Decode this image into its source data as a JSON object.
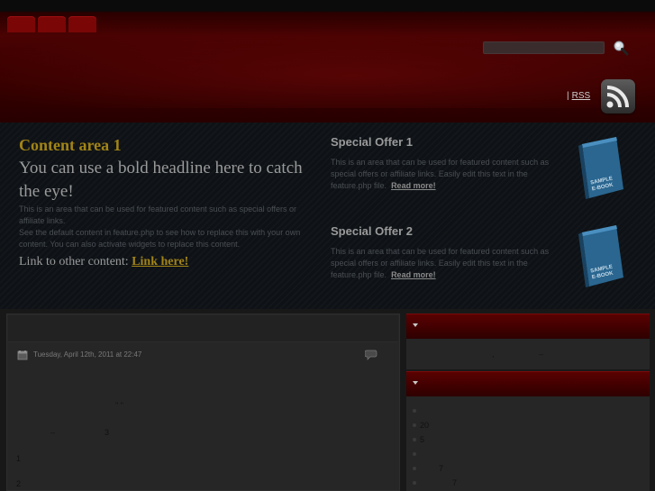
{
  "header": {
    "search": {
      "placeholder": "",
      "icon": "search-icon"
    },
    "rss": {
      "sep_link": "",
      "divider": "|",
      "label": "RSS"
    },
    "colors": {
      "nav_tab": "#7a0606",
      "header_red": "#4a0202"
    }
  },
  "feature": {
    "content_area": {
      "title": "Content area 1",
      "headline": "You can use a bold headline here to catch the eye!",
      "text1": "This is an area that can be used for featured content such as special offers or affiliate links.",
      "text2": "See the default content in feature.php to see how to replace this with your own content. You can also activate widgets to replace this content.",
      "link_prefix": "Link to other content:",
      "link_label": "Link here!"
    },
    "offers": [
      {
        "title": "Special Offer 1",
        "text": "This is an area that can be used for featured content such as special offers or affiliate links. Easily edit this text in the feature.php file.",
        "link": "Read more!",
        "book_label": "SAMPLE E-BOOK"
      },
      {
        "title": "Special Offer 2",
        "text": "This is an area that can be used for featured content such as special offers or affiliate links. Easily edit this text in the feature.php file.",
        "link": "Read more!",
        "book_label": "SAMPLE E-BOOK"
      }
    ],
    "colors": {
      "accent_gold": "#a28416",
      "book_blue": "#2f6f9a"
    }
  },
  "post": {
    "date": "Tuesday, April 12th, 2011 at 22:47",
    "fragments": {
      "f1": "\" \"",
      "f2": "–",
      "f3": "3",
      "f4": "1",
      "f5": "2"
    }
  },
  "sidebar": {
    "widget1": {
      "frag_a": ",",
      "frag_b": "–"
    },
    "widget2": {
      "items": [
        "",
        "20",
        "5",
        "",
        "7",
        "7"
      ]
    }
  }
}
